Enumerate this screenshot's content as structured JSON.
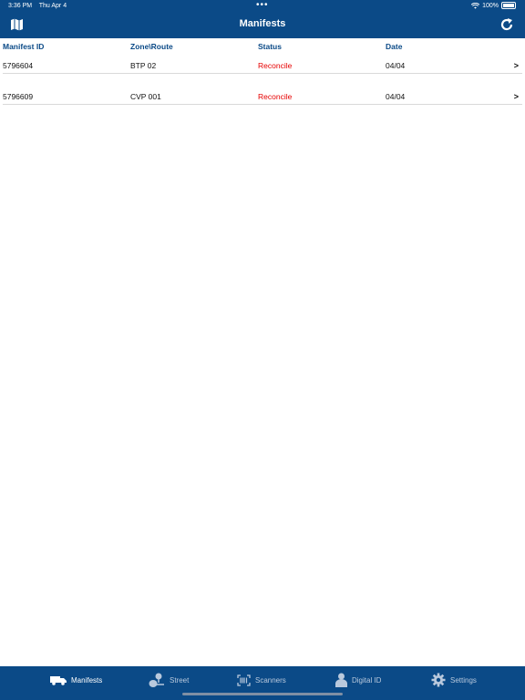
{
  "status_bar": {
    "time": "3:36 PM",
    "date": "Thu Apr 4",
    "battery": "100%"
  },
  "nav": {
    "title": "Manifests"
  },
  "table": {
    "headers": [
      "Manifest ID",
      "Zone\\Route",
      "Status",
      "Date"
    ],
    "rows": [
      {
        "id": "5796604",
        "zone": "BTP 02",
        "status": "Reconcile",
        "date": "04/04",
        "chevron": ">"
      },
      {
        "id": "5796609",
        "zone": "CVP 001",
        "status": "Reconcile",
        "date": "04/04",
        "chevron": ">"
      }
    ]
  },
  "tabs": [
    {
      "label": "Manifests",
      "icon": "truck-icon",
      "active": true
    },
    {
      "label": "Street",
      "icon": "street-pin-icon",
      "active": false
    },
    {
      "label": "Scanners",
      "icon": "barcode-scanner-icon",
      "active": false
    },
    {
      "label": "Digital ID",
      "icon": "person-icon",
      "active": false
    },
    {
      "label": "Settings",
      "icon": "gear-icon",
      "active": false
    }
  ],
  "colors": {
    "primary": "#0b4a87",
    "status_red": "#e60000",
    "header_text": "#0b4a87"
  }
}
